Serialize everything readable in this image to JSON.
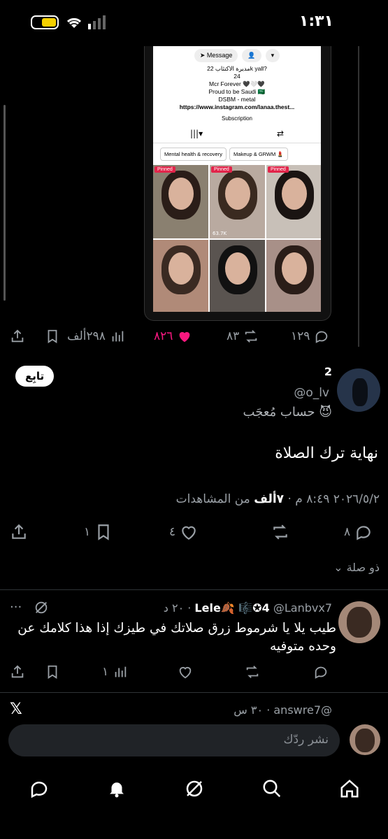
{
  "status_bar": {
    "time": "١:٣١"
  },
  "embedded_profile": {
    "message_btn": "Message",
    "bio_lines": [
      "مديرة الاكتئاب 22k yall?",
      "24",
      "Mcr Forever 🖤🤍🖤",
      "Proud to be Saudi 🇸🇦",
      "DSBM - metal"
    ],
    "link": "https://www.instagram.com/lanaa.thest...",
    "subscription": "Subscription",
    "chips": [
      "Mental health & recovery",
      "Makeup & GRWM 💄"
    ],
    "pinned_label": "Pinned",
    "cell_views": [
      "",
      "63.7K",
      "",
      "",
      "",
      ""
    ]
  },
  "post_actions": {
    "replies": "١٢٩",
    "reposts": "٨٣",
    "likes": "٨٢٦",
    "views": "٢٩٨ألف"
  },
  "main_post": {
    "follow_label": "تابِع",
    "display_name": "2",
    "handle": "@o_lv",
    "bio": "😈 حساب مُعجَب",
    "text": "نهاية ترك الصلاة",
    "meta_time": "٢٠٢٦/٥/٢ ٨:٤٩ م",
    "meta_views_count": "٧ألف",
    "meta_views_label": "من المشاهدات",
    "replies": "٨",
    "reposts": "",
    "likes": "٤",
    "bookmarks": "١"
  },
  "related_label": "ذو صلة",
  "reply1": {
    "display_name": "Lele🍂 🎼✪4",
    "handle": "@Lanbvx7",
    "time": "٢٠ د",
    "text": "طيب يلا يا شرموط زرق صلاتك في طيزك إذا هذا كلامك عن وحده متوفيه",
    "views": "١"
  },
  "reply2": {
    "handle": "@answre7",
    "time": "٣٠ س"
  },
  "compose": {
    "placeholder": "نشر ردّك"
  },
  "colors": {
    "like_active": "#f91880",
    "background": "#000000",
    "muted": "#9aa0a6"
  }
}
